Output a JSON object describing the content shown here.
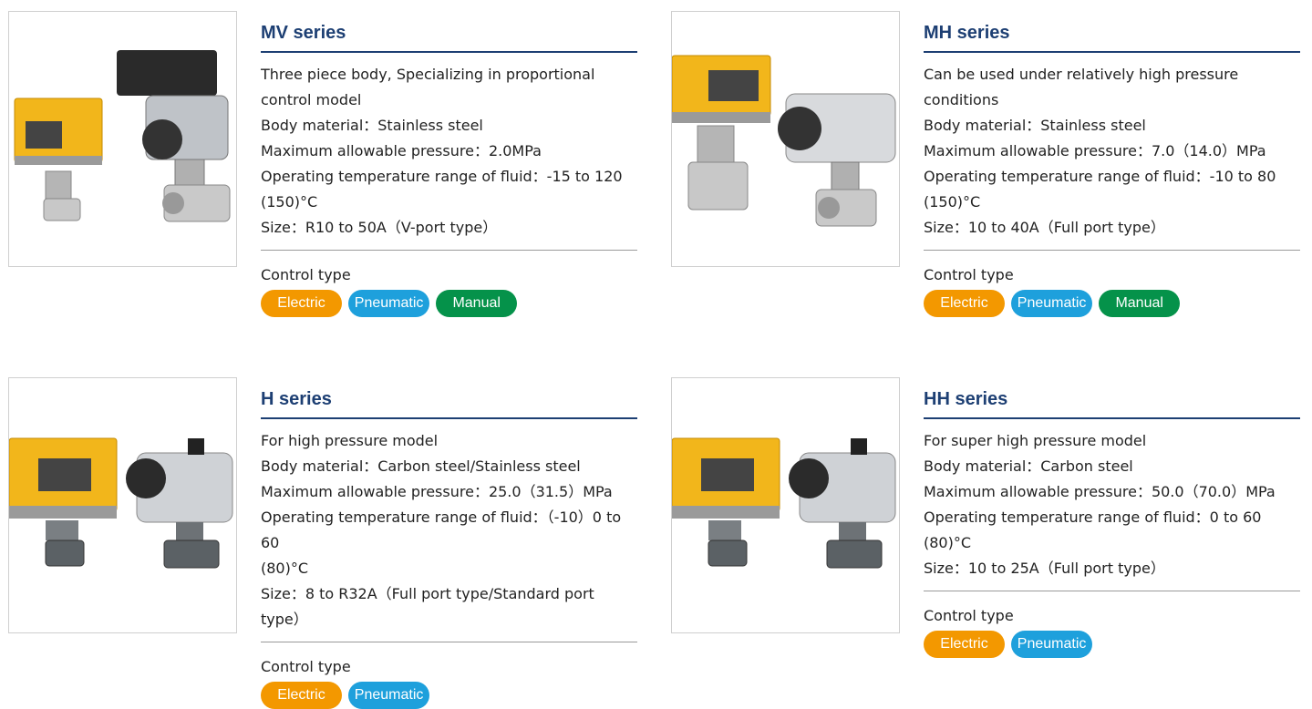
{
  "colors": {
    "electric": "#f39800",
    "pneumatic": "#1ea0dc",
    "manual": "#05924a",
    "title": "#1d3f73"
  },
  "products": [
    {
      "title": "MV series",
      "lines": [
        "Three piece body, Specializing in proportional",
        "control model",
        "Body material：Stainless steel",
        "Maximum allowable pressure：2.0MPa",
        "Operating temperature range of fluid：-15 to 120",
        "(150)°C",
        "Size：R10 to 50A（V-port type）"
      ],
      "control_label": "Control type",
      "controls": [
        "Electric",
        "Pneumatic",
        "Manual"
      ],
      "image_icon": "valve-actuator-photo"
    },
    {
      "title": "MH series",
      "lines": [
        "Can be used under relatively high pressure",
        "conditions",
        "Body material：Stainless steel",
        "Maximum allowable pressure：7.0（14.0）MPa",
        "Operating temperature range of fluid：-10 to 80",
        "(150)°C",
        "Size：10 to 40A（Full port type）"
      ],
      "control_label": "Control type",
      "controls": [
        "Electric",
        "Pneumatic",
        "Manual"
      ],
      "image_icon": "valve-actuator-photo"
    },
    {
      "title": "H series",
      "lines": [
        "For high pressure model",
        "Body material：Carbon steel/Stainless steel",
        "Maximum allowable pressure：25.0（31.5）MPa",
        "Operating temperature range of fluid：（-10）0 to 60",
        "(80)°C",
        "Size：8 to R32A（Full port type/Standard port type）"
      ],
      "control_label": "Control type",
      "controls": [
        "Electric",
        "Pneumatic"
      ],
      "image_icon": "valve-actuator-photo"
    },
    {
      "title": "HH series",
      "lines": [
        "For super high pressure model",
        "Body material：Carbon steel",
        "Maximum allowable pressure：50.0（70.0）MPa",
        "Operating temperature range of fluid：0 to 60",
        "(80)°C",
        "Size：10 to 25A（Full port type）"
      ],
      "control_label": "Control type",
      "controls": [
        "Electric",
        "Pneumatic"
      ],
      "image_icon": "valve-actuator-photo"
    }
  ]
}
